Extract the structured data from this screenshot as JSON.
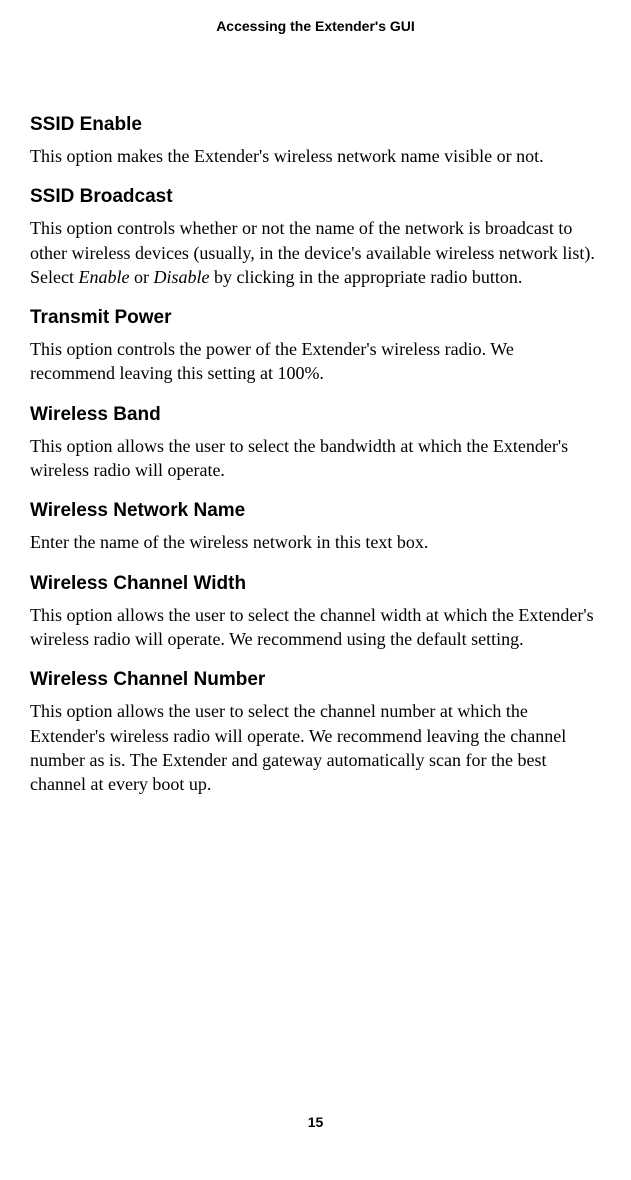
{
  "header": "Accessing the Extender's GUI",
  "sections": [
    {
      "heading": "SSID Enable",
      "body_parts": [
        "This option makes the Extender's wireless network name visible or not."
      ]
    },
    {
      "heading": "SSID Broadcast",
      "body_parts": [
        "This option controls whether or not the name of the network is broadcast to other wireless devices (usually, in the device's available wireless network list). Select ",
        {
          "italic": "Enable"
        },
        " or ",
        {
          "italic": "Disable"
        },
        " by clicking in the appropriate radio button."
      ]
    },
    {
      "heading": "Transmit Power",
      "body_parts": [
        "This option controls the power of the Extender's wireless radio. We recommend leaving this setting at 100%."
      ]
    },
    {
      "heading": "Wireless Band",
      "body_parts": [
        "This option allows the user to select the bandwidth at which the Extender's wireless radio will operate."
      ]
    },
    {
      "heading": "Wireless Network Name",
      "body_parts": [
        "Enter the name of the wireless network in this text box."
      ]
    },
    {
      "heading": "Wireless Channel Width",
      "body_parts": [
        "This option allows the user to select the channel width at which the Extender's wireless radio will operate. We recommend using the default setting."
      ]
    },
    {
      "heading": "Wireless Channel Number",
      "body_parts": [
        "This option allows the user to select the channel number at which the Extender's wireless radio will operate. We recommend leaving the channel number as is. The Extender and gateway automatically scan for the best channel at every boot up."
      ]
    }
  ],
  "page_number": "15"
}
